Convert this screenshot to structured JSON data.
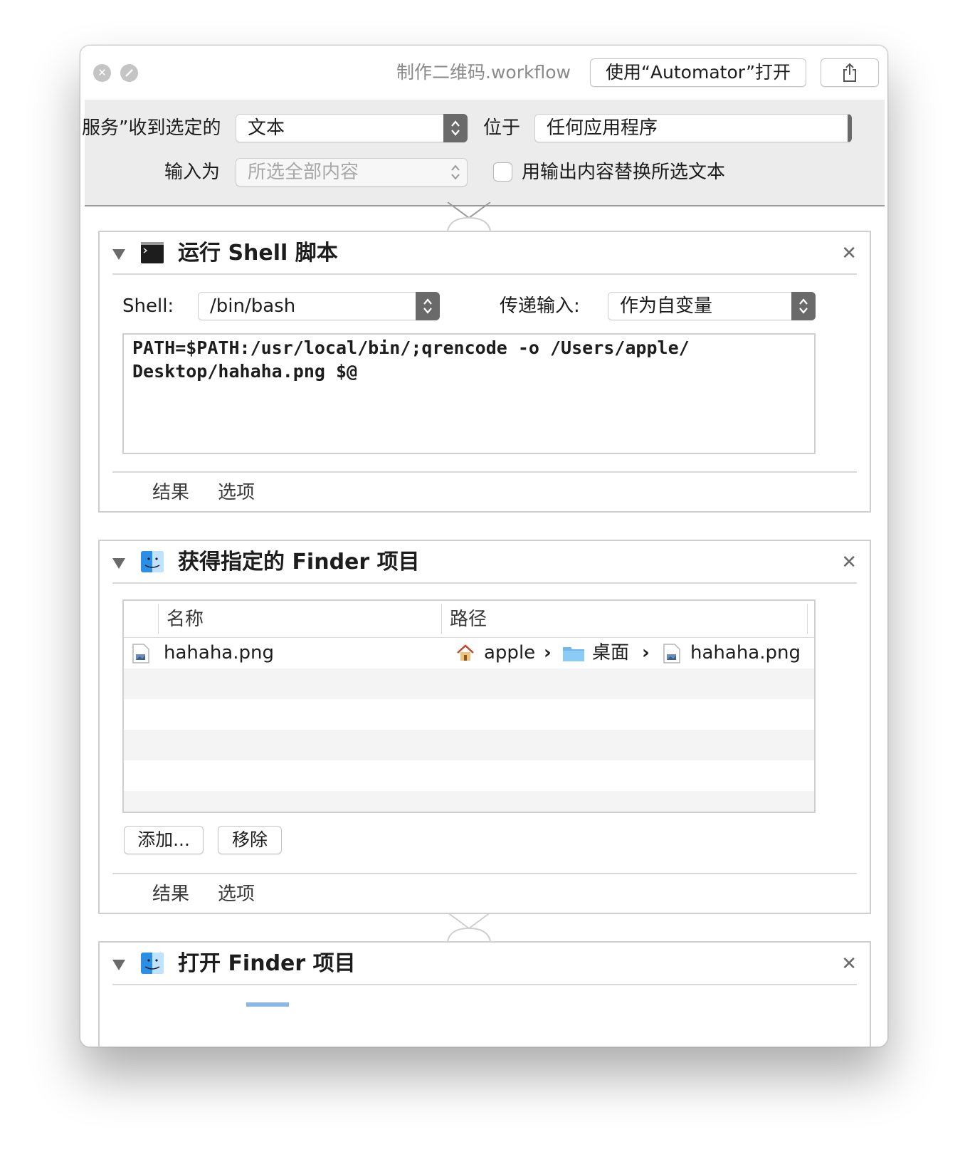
{
  "window": {
    "title": "制作二维码.workflow",
    "open_button": "使用“Automator”打开"
  },
  "service": {
    "receives_label": "服务”收到选定的",
    "input_type": "文本",
    "in_label": "位于",
    "application": "任何应用程序",
    "input_is_label": "输入为",
    "input_is_value": "所选全部内容",
    "replace_label": "用输出内容替换所选文本"
  },
  "actions": [
    {
      "title": "运行 Shell 脚本",
      "shell_label": "Shell:",
      "shell_value": "/bin/bash",
      "pass_input_label": "传递输入:",
      "pass_input_value": "作为自变量",
      "script": "PATH=$PATH:/usr/local/bin/;qrencode -o /Users/apple/\nDesktop/hahaha.png $@",
      "results_label": "结果",
      "options_label": "选项"
    },
    {
      "title": "获得指定的 Finder 项目",
      "columns": [
        "名称",
        "路径"
      ],
      "rows": [
        {
          "name": "hahaha.png",
          "path": [
            "apple",
            "桌面",
            "hahaha.png"
          ]
        }
      ],
      "add_button": "添加...",
      "remove_button": "移除",
      "results_label": "结果",
      "options_label": "选项"
    },
    {
      "title": "打开 Finder 项目"
    }
  ],
  "icons": {
    "close": "close-icon",
    "minimize": "minimize-icon",
    "share": "share-icon",
    "terminal": "terminal-icon",
    "finder": "finder-icon",
    "home": "home-icon",
    "folder": "folder-icon",
    "image_file": "image-file-icon",
    "path_separator": "›"
  }
}
